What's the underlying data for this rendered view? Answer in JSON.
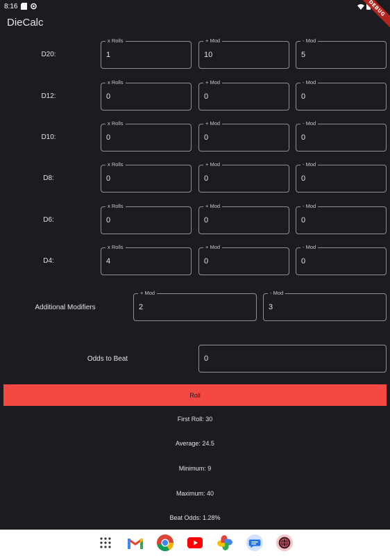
{
  "status": {
    "time": "8:16"
  },
  "debug_banner": "DEBUG",
  "app": {
    "title": "DieCalc"
  },
  "dice": [
    {
      "label": "D20:",
      "x_rolls_label": "x Rolls",
      "x_rolls": "1",
      "plus_mod_label": "+ Mod",
      "plus_mod": "10",
      "minus_mod_label": "- Mod",
      "minus_mod": "5"
    },
    {
      "label": "D12:",
      "x_rolls_label": "x Rolls",
      "x_rolls": "0",
      "plus_mod_label": "+ Mod",
      "plus_mod": "0",
      "minus_mod_label": "- Mod",
      "minus_mod": "0"
    },
    {
      "label": "D10:",
      "x_rolls_label": "x Rolls",
      "x_rolls": "0",
      "plus_mod_label": "+ Mod",
      "plus_mod": "0",
      "minus_mod_label": "- Mod",
      "minus_mod": "0"
    },
    {
      "label": "D8:",
      "x_rolls_label": "x Rolls",
      "x_rolls": "0",
      "plus_mod_label": "+ Mod",
      "plus_mod": "0",
      "minus_mod_label": "- Mod",
      "minus_mod": "0"
    },
    {
      "label": "D6:",
      "x_rolls_label": "x Rolls",
      "x_rolls": "0",
      "plus_mod_label": "+ Mod",
      "plus_mod": "0",
      "minus_mod_label": "- Mod",
      "minus_mod": "0"
    },
    {
      "label": "D4:",
      "x_rolls_label": "x Rolls",
      "x_rolls": "4",
      "plus_mod_label": "+ Mod",
      "plus_mod": "0",
      "minus_mod_label": "- Mod",
      "minus_mod": "0"
    }
  ],
  "additional": {
    "label": "Additional Modifiers",
    "plus_mod_label": "+ Mod",
    "plus_mod": "2",
    "minus_mod_label": "- Mod",
    "minus_mod": "3"
  },
  "odds": {
    "label": "Odds to Beat",
    "value": "0"
  },
  "roll_button": "Roll",
  "results": {
    "first_roll": "First Roll: 30",
    "average": "Average: 24.5",
    "minimum": "Minimum: 9",
    "maximum": "Maximum: 40",
    "beat_odds": "Beat Odds: 1.28%"
  },
  "colors": {
    "background": "#1c1b1f",
    "accent": "#f44943",
    "outline": "#938f99"
  },
  "dock_icons": [
    "app-drawer-icon",
    "gmail-icon",
    "chrome-icon",
    "youtube-icon",
    "photos-icon",
    "messages-icon",
    "browser-icon"
  ]
}
